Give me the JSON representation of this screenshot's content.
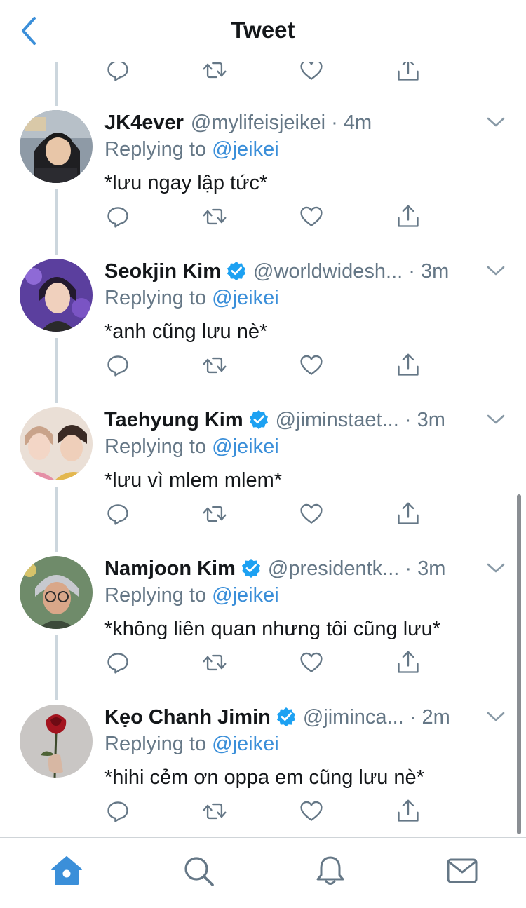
{
  "header": {
    "title": "Tweet",
    "back_icon": "chevron-left-icon"
  },
  "colors": {
    "accent": "#3b8fd9",
    "text": "#14171a",
    "secondary": "#657786",
    "thread_line": "#ccd6dd",
    "verified": "#1da1f2"
  },
  "tweets": [
    {
      "name": "JK4ever",
      "verified": false,
      "handle": "@mylifeisjeikei",
      "dot": "·",
      "time": "4m",
      "replying_prefix": "Replying to",
      "replying_to": "@jeikei",
      "text": "*lưu ngay lập tức*"
    },
    {
      "name": "Seokjin Kim",
      "verified": true,
      "handle": "@worldwidesh...",
      "dot": "·",
      "time": "3m",
      "replying_prefix": "Replying to",
      "replying_to": "@jeikei",
      "text": "*anh cũng lưu nè*"
    },
    {
      "name": "Taehyung Kim",
      "verified": true,
      "handle": "@jiminstaet...",
      "dot": "·",
      "time": "3m",
      "replying_prefix": "Replying to",
      "replying_to": "@jeikei",
      "text": "*lưu vì mlem mlem*"
    },
    {
      "name": "Namjoon Kim",
      "verified": true,
      "handle": "@presidentk...",
      "dot": "·",
      "time": "3m",
      "replying_prefix": "Replying to",
      "replying_to": "@jeikei",
      "text": "*không liên quan nhưng tôi cũng lưu*"
    },
    {
      "name": "Kẹo Chanh Jimin",
      "verified": true,
      "handle": "@jiminca...",
      "dot": "·",
      "time": "2m",
      "replying_prefix": "Replying to",
      "replying_to": "@jeikei",
      "text": "*hihi cẻm ơn oppa em cũng lưu nè*"
    }
  ],
  "actions": [
    "reply-icon",
    "retweet-icon",
    "like-icon",
    "share-icon"
  ],
  "tabbar": {
    "tabs": [
      "home-icon",
      "search-icon",
      "notifications-icon",
      "messages-icon"
    ],
    "active": "home-icon"
  }
}
